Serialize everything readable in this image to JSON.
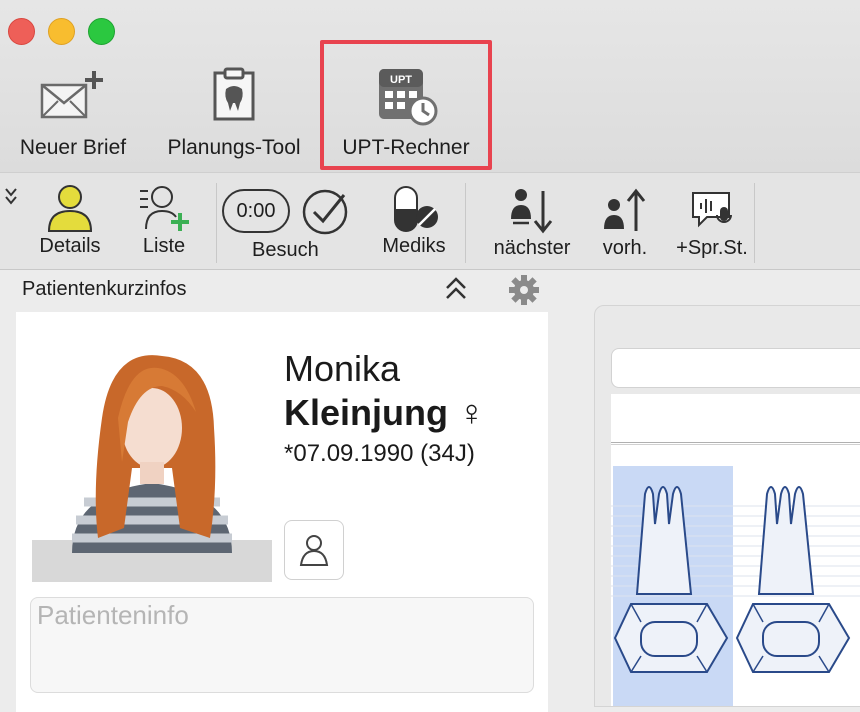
{
  "window": {
    "traffic_lights": [
      {
        "name": "close",
        "color": "#ee5f58"
      },
      {
        "name": "minimize",
        "color": "#f8bd2f"
      },
      {
        "name": "zoom",
        "color": "#2bc840"
      }
    ]
  },
  "toolbar": {
    "neuer_brief": "Neuer Brief",
    "planungs_tool": "Planungs-Tool",
    "upt_rechner": "UPT-Rechner",
    "upt_icon_text": "UPT"
  },
  "toolbar2": {
    "details": "Details",
    "liste": "Liste",
    "timer": "0:00",
    "besuch": "Besuch",
    "mediks": "Mediks",
    "naechster": "nächster",
    "vorh": "vorh.",
    "spr_st": "+Spr.St."
  },
  "panel": {
    "title": "Patientenkurzinfos"
  },
  "patient": {
    "first_name": "Monika",
    "last_name": "Kleinjung ♀",
    "dob": "*07.09.1990 (34J)",
    "info_placeholder": "Patienteninfo"
  },
  "colors": {
    "highlight": "#e8434f",
    "accent_green": "#3cb054",
    "tooth_selected": "#c9d9f5"
  }
}
